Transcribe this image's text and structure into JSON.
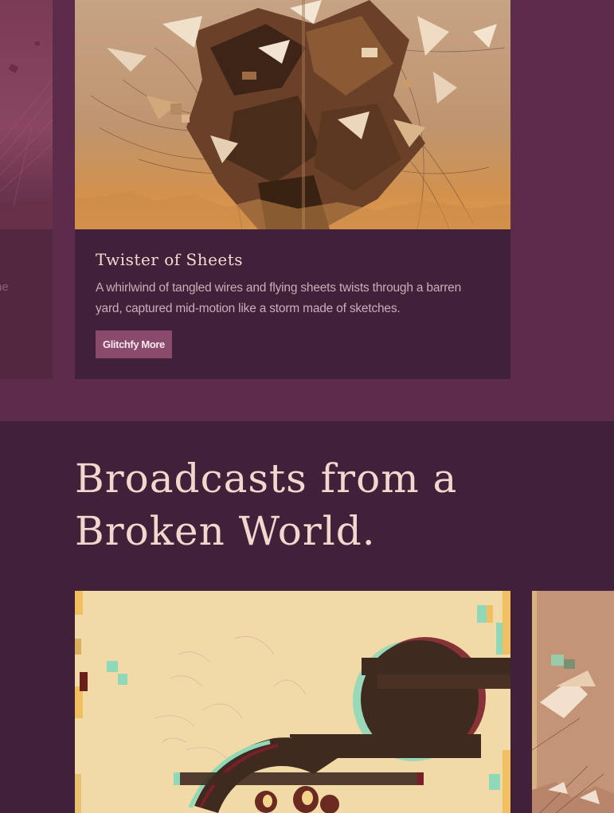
{
  "top_carousel": {
    "left_peek_text": "he",
    "feature_card": {
      "image_alt": "Glitched artwork of tangled wires and flying sheets",
      "title": "Twister of Sheets",
      "description_line1": "A whirlwind of tangled wires and flying sheets twists through a barren",
      "description_line2": "yard, captured mid-motion like a storm made of sketches.",
      "button_label": "Glitchfy More"
    }
  },
  "broadcasts": {
    "heading_line1": "Broadcasts from a",
    "heading_line2": "Broken World."
  },
  "colors": {
    "top_section_bg": "#5e2c4b",
    "page_bg": "#41203a",
    "card_bg": "#41203a",
    "button_bg": "#8a4a6c",
    "heading_text": "#f0d8cf",
    "body_text": "#c9aeb9",
    "gallery_card_bg": "#f2d9a8"
  }
}
